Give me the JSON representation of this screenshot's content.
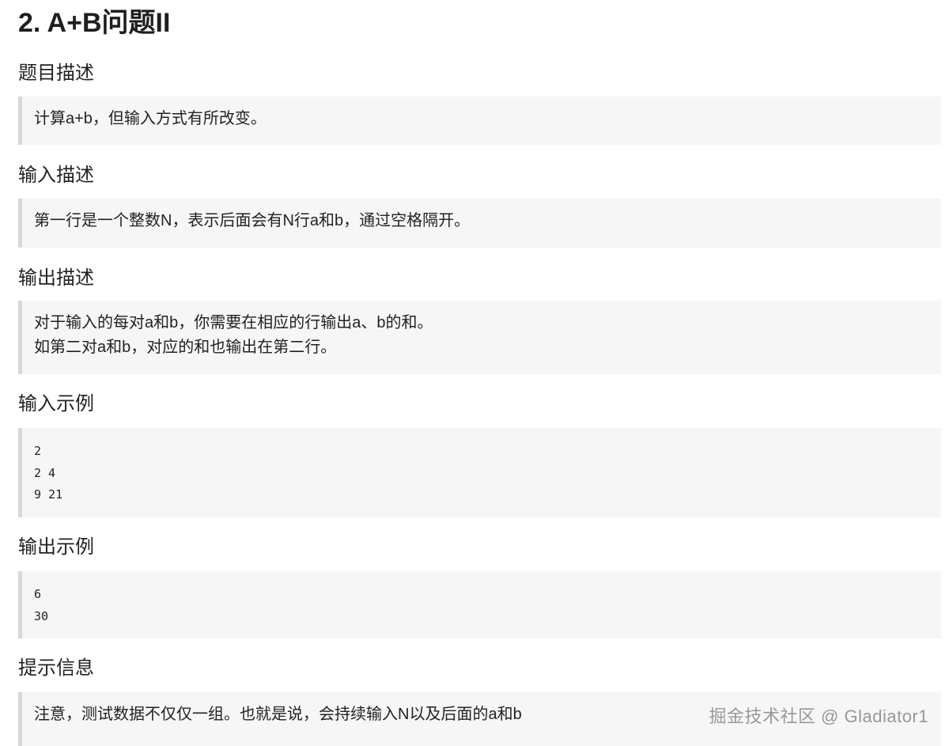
{
  "title": "2. A+B问题II",
  "sections": [
    {
      "heading": "题目描述",
      "lines": [
        "计算a+b，但输入方式有所改变。"
      ]
    },
    {
      "heading": "输入描述",
      "lines": [
        "第一行是一个整数N，表示后面会有N行a和b，通过空格隔开。"
      ]
    },
    {
      "heading": "输出描述",
      "lines": [
        "对于输入的每对a和b，你需要在相应的行输出a、b的和。",
        "如第二对a和b，对应的和也输出在第二行。"
      ]
    },
    {
      "heading": "输入示例",
      "code": [
        "2",
        "2 4",
        "9 21"
      ]
    },
    {
      "heading": "输出示例",
      "code": [
        "6",
        "30"
      ]
    },
    {
      "heading": "提示信息",
      "lines": [
        "注意，测试数据不仅仅一组。也就是说，会持续输入N以及后面的a和b"
      ]
    }
  ],
  "watermark": "掘金技术社区 @ Gladiator1"
}
